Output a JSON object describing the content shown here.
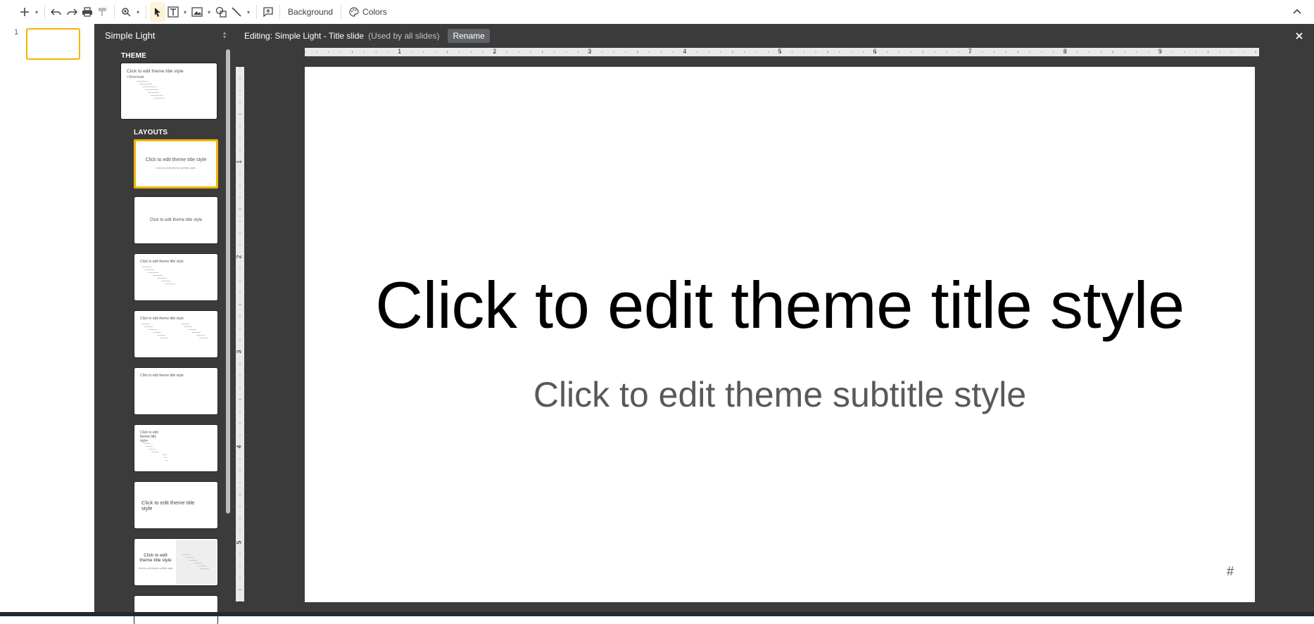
{
  "toolbar": {
    "background_label": "Background",
    "colors_label": "Colors"
  },
  "filmstrip": {
    "slides": [
      {
        "number": "1"
      }
    ]
  },
  "master_panel": {
    "theme_name": "Simple Light",
    "theme_section_label": "THEME",
    "layouts_section_label": "LAYOUTS",
    "theme_thumb_title": "Click to edit theme title style",
    "theme_thumb_body": "• First level",
    "layouts": [
      {
        "title": "Click to edit theme title style",
        "subtitle": "Click to edit theme subtitle style"
      },
      {
        "title": "Click to edit theme title style"
      },
      {
        "title": "Click to edit theme title style"
      },
      {
        "title": "Click to edit theme title style"
      },
      {
        "title": "Click to edit theme title style"
      },
      {
        "title": "Click to edit theme title style"
      },
      {
        "title": "Click to edit theme title style"
      },
      {
        "title": "Click to edit theme title style",
        "subtitle": "Click to edit theme subtitle style"
      },
      {
        "title": ""
      }
    ]
  },
  "editing_bar": {
    "title": "Editing: Simple Light - Title slide",
    "used_by": "(Used by all slides)",
    "rename_label": "Rename"
  },
  "ruler": {
    "horizontal": [
      "1",
      "2",
      "3",
      "4",
      "5",
      "6",
      "7",
      "8",
      "9"
    ],
    "vertical": [
      "1",
      "2",
      "3",
      "4",
      "5"
    ]
  },
  "slide": {
    "title": "Click to edit theme title style",
    "subtitle": "Click to edit theme subtitle style",
    "slide_number": "#"
  },
  "colors": {
    "accent": "#f4b400",
    "panel_bg": "#3b3b3b"
  }
}
